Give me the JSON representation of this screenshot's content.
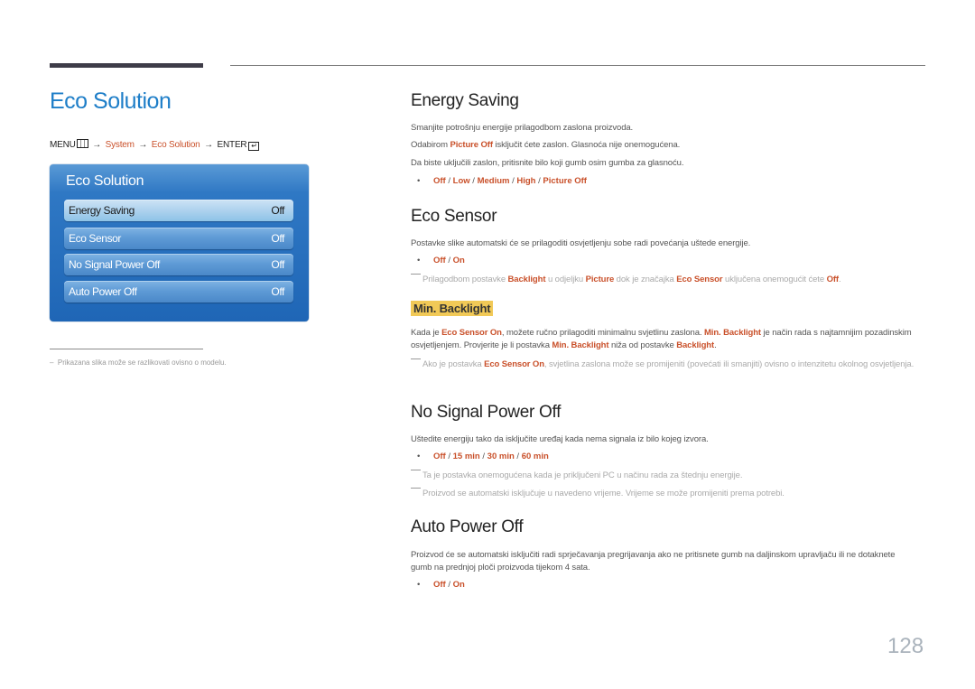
{
  "page": {
    "title": "Eco Solution",
    "page_number": "128",
    "footnote": "Prikazana slika može se razlikovati ovisno o modelu."
  },
  "path": {
    "menu": "MENU",
    "system": "System",
    "eco_solution": "Eco Solution",
    "enter": "ENTER",
    "arrow": "→"
  },
  "osd": {
    "title": "Eco Solution",
    "items": [
      {
        "label": "Energy Saving",
        "value": "Off",
        "selected": true
      },
      {
        "label": "Eco Sensor",
        "value": "Off",
        "selected": false
      },
      {
        "label": "No Signal Power Off",
        "value": "Off",
        "selected": false
      },
      {
        "label": "Auto Power Off",
        "value": "Off",
        "selected": false
      }
    ]
  },
  "sections": {
    "energy_saving": {
      "title": "Energy Saving",
      "p1": "Smanjite potrošnju energije prilagodbom zaslona proizvoda.",
      "p2_pre": "Odabirom ",
      "p2_b": "Picture Off",
      "p2_post": " isključit ćete zaslon. Glasnoća nije onemogućena.",
      "p3": "Da biste uključili zaslon, pritisnite bilo koji gumb osim gumba za glasnoću.",
      "options": [
        "Off",
        "Low",
        "Medium",
        "High",
        "Picture Off"
      ]
    },
    "eco_sensor": {
      "title": "Eco Sensor",
      "p1": "Postavke slike automatski će se prilagoditi osvjetljenju sobe radi povećanja uštede energije.",
      "options": [
        "Off",
        "On"
      ],
      "note": {
        "t1": "Prilagodbom postavke ",
        "b1": "Backlight",
        "t2": " u odjeljku ",
        "b2": "Picture",
        "t3": " dok je značajka ",
        "b3": "Eco Sensor",
        "t4": " uključena onemogućit ćete ",
        "b4": "Off",
        "t5": "."
      }
    },
    "min_backlight": {
      "title": "Min. Backlight",
      "p": {
        "t1": "Kada je ",
        "b1": "Eco Sensor On",
        "t2": ", možete ručno prilagoditi minimalnu svjetlinu zaslona. ",
        "b2": "Min. Backlight",
        "t3": " je način rada s najtamnijim pozadinskim osvjetljenjem. Provjerite je li postavka ",
        "b3": "Min. Backlight",
        "t4": " niža od postavke ",
        "b4": "Backlight",
        "t5": "."
      },
      "note": {
        "t1": "Ako je postavka ",
        "b1": "Eco Sensor On",
        "t2": ", svjetlina zaslona može se promijeniti (povećati ili smanjiti) ovisno o intenzitetu okolnog osvjetljenja."
      }
    },
    "no_signal": {
      "title": "No Signal Power Off",
      "p1": "Uštedite energiju tako da isključite uređaj kada nema signala iz bilo kojeg izvora.",
      "options": [
        "Off",
        "15 min",
        "30 min",
        "60 min"
      ],
      "note1": "Ta je postavka onemogućena kada je priključeni PC u načinu rada za štednju energije.",
      "note2": "Proizvod se automatski isključuje u navedeno vrijeme. Vrijeme se može promijeniti prema potrebi."
    },
    "auto_power_off": {
      "title": "Auto Power Off",
      "p1": "Proizvod će se automatski isključiti radi sprječavanja pregrijavanja ako ne pritisnete gumb na daljinskom upravljaču ili ne dotaknete gumb na prednjoj ploči proizvoda tijekom 4 sata.",
      "options": [
        "Off",
        "On"
      ]
    }
  },
  "colors": {
    "title_blue": "#1e7ec8",
    "highlight_orange": "#c9502a",
    "subheading_bg": "#f1c957",
    "osd_blue": "#1f66b6"
  }
}
